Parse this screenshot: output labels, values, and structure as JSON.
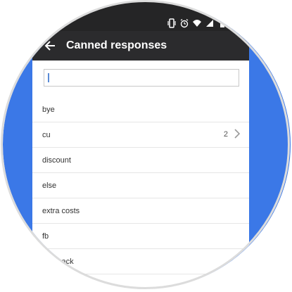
{
  "status_bar": {
    "icons": [
      "vibrate-icon",
      "alarm-icon",
      "wifi-icon",
      "signal-icon",
      "battery-icon"
    ]
  },
  "app_bar": {
    "title": "Canned responses"
  },
  "search": {
    "value": "",
    "placeholder": ""
  },
  "list": {
    "items": [
      {
        "label": "bye",
        "count": ""
      },
      {
        "label": "cu",
        "count": "2"
      },
      {
        "label": "discount",
        "count": ""
      },
      {
        "label": "else",
        "count": ""
      },
      {
        "label": "extra costs",
        "count": ""
      },
      {
        "label": "fb",
        "count": ""
      },
      {
        "label": "feedback",
        "count": ""
      }
    ]
  },
  "colors": {
    "background_circle": "#3b78e7",
    "app_bar": "#2b2b2d",
    "status_bar": "#252526",
    "caret": "#5a8bd6"
  }
}
